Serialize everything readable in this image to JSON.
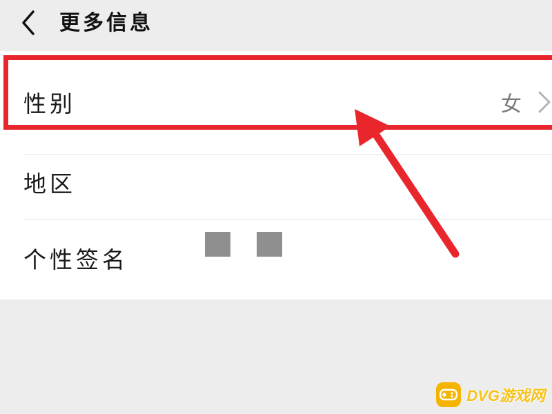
{
  "header": {
    "back_icon": "chevron-left-icon",
    "title": "更多信息"
  },
  "list": {
    "items": [
      {
        "label": "性别",
        "value": "女",
        "icon": "chevron-right-icon"
      },
      {
        "label": "地区"
      },
      {
        "label": "个性签名"
      }
    ]
  },
  "annotation": {
    "highlight_color": "#e8262c",
    "arrow_color": "#e8262c"
  },
  "watermark": {
    "logo_icon": "gamepad-icon",
    "text": "DVG游戏网",
    "color": "#f7c21a"
  }
}
